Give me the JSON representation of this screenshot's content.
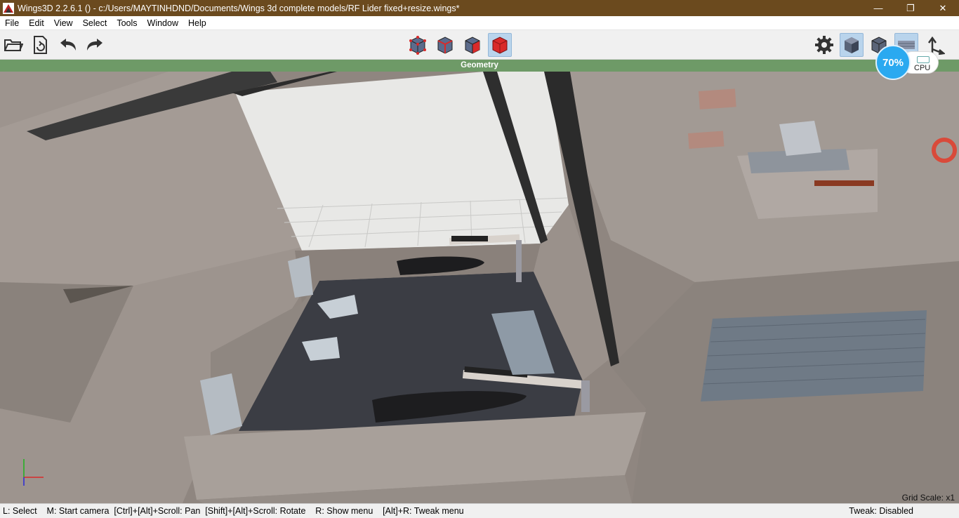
{
  "window": {
    "title": "Wings3D 2.2.6.1 () - c:/Users/MAYTINHDND/Documents/Wings 3d complete models/RF Lider fixed+resize.wings*",
    "controls": {
      "minimize": "—",
      "restore": "❐",
      "close": "✕"
    }
  },
  "menu": {
    "items": [
      "File",
      "Edit",
      "View",
      "Select",
      "Tools",
      "Window",
      "Help"
    ]
  },
  "toolbar": {
    "left_icons": [
      "open-folder-icon",
      "save-file-icon",
      "undo-icon",
      "redo-icon"
    ],
    "selection_modes": [
      "vertex-mode-icon",
      "edge-mode-icon",
      "face-mode-icon",
      "object-mode-icon"
    ],
    "active_selection_mode": "object-mode-icon",
    "right_icons": [
      "gear-icon",
      "smooth-shaded-cube-icon",
      "wireframe-cube-icon",
      "ground-plane-icon",
      "axes-toggle-icon"
    ]
  },
  "geometry_bar": {
    "label": "Geometry"
  },
  "cpu_widget": {
    "percent": "70%",
    "label": "CPU"
  },
  "viewport": {
    "grid_scale": "Grid Scale: x1"
  },
  "status": {
    "help_text": "L: Select    M: Start camera  [Ctrl]+[Alt]+Scroll: Pan  [Shift]+[Alt]+Scroll: Rotate    R: Show menu    [Alt]+R: Tweak menu",
    "tweak": "Tweak: Disabled"
  },
  "colors": {
    "titlebar": "#6b4a1e",
    "geometry_bar": "#6e9a67",
    "selection_red": "#d92a2a",
    "cpu_blue": "#2aa9f0"
  }
}
